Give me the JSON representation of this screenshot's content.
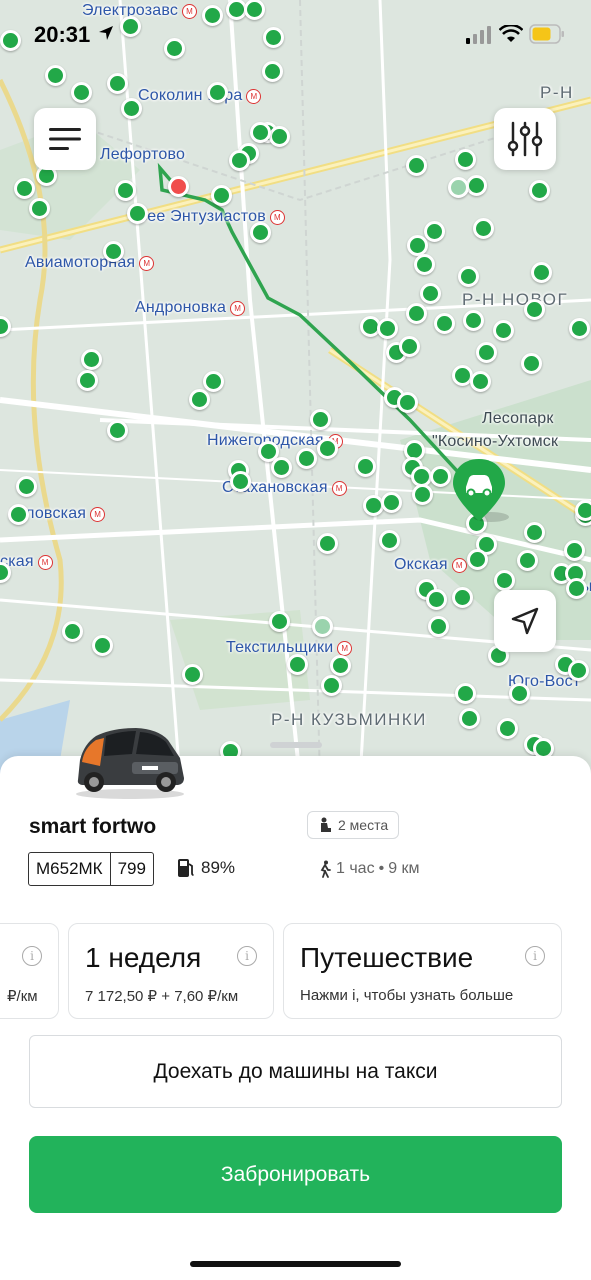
{
  "status_bar": {
    "time": "20:31"
  },
  "map": {
    "labels": {
      "elektrozavodskaya": "Электрозавс",
      "sokolinaya_gora": "Соколин Гора",
      "lefortovo": "Лефортово",
      "shosse_entuziastov": "осее Энтузиастов",
      "aviamotornaya": "Авиамоторная",
      "andronovka": "Андроновка",
      "rn_novog": "Р-Н НОВОГ",
      "rn_top": "Р-Н",
      "lesopark_1": "Лесопарк",
      "lesopark_2": "\"Косино-Ухтомск",
      "nizhegorodskaya": "Нижегородская",
      "stakhanovskaya": "Стахановская",
      "okhovskaya": "охловская",
      "skaya": "ская",
      "okskaya": "Окская",
      "vy": "Вы",
      "tekstilshchiki": "Текстильщики",
      "yugo_vost": "Юго-Вост",
      "rn_kuzminki": "Р-Н КУЗЬМИНКИ"
    }
  },
  "car": {
    "name": "smart fortwo",
    "seats": "2 места",
    "plate_number": "М652МК",
    "plate_region": "799",
    "fuel": "89%",
    "walk_time": "1 час",
    "walk_sep": "•",
    "walk_distance": "9 км"
  },
  "tariffs": [
    {
      "name": "",
      "price": "₽/км"
    },
    {
      "name": "1 неделя",
      "price": "7 172,50 ₽ + 7,60 ₽/км"
    },
    {
      "name": "Путешествие",
      "price": "Нажми i, чтобы узнать больше"
    }
  ],
  "buttons": {
    "taxi": "Доехать до машины на такси",
    "book": "Забронировать"
  },
  "colors": {
    "accent_green": "#22b35b",
    "marker_green": "#22a848",
    "route_green": "#2fa44f",
    "metro_red": "#d33333"
  },
  "icons": [
    "menu-icon",
    "filter-icon",
    "locate-icon",
    "car-pin-icon",
    "seat-icon",
    "fuel-icon",
    "walk-icon",
    "info-icon"
  ]
}
